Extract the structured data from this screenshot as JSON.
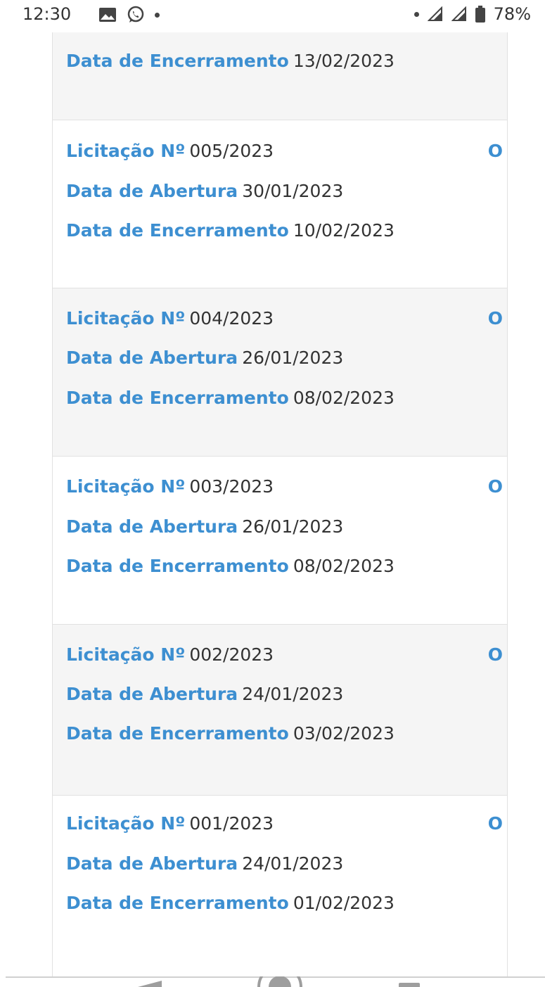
{
  "status_bar": {
    "time": "12:30",
    "battery": "78%",
    "icons": [
      "image-icon",
      "whatsapp-icon",
      "signal-icon",
      "battery-icon"
    ]
  },
  "labels": {
    "licitacao": "Licitação Nº",
    "abertura": "Data de Abertura",
    "encerramento": "Data de Encerramento"
  },
  "items": [
    {
      "encerramento": "13/02/2023"
    },
    {
      "numero": "005/2023",
      "abertura": "30/01/2023",
      "encerramento": "10/02/2023",
      "badge": "O"
    },
    {
      "numero": "004/2023",
      "abertura": "26/01/2023",
      "encerramento": "08/02/2023",
      "badge": "O"
    },
    {
      "numero": "003/2023",
      "abertura": "26/01/2023",
      "encerramento": "08/02/2023",
      "badge": "O"
    },
    {
      "numero": "002/2023",
      "abertura": "24/01/2023",
      "encerramento": "03/02/2023",
      "badge": "O"
    },
    {
      "numero": "001/2023",
      "abertura": "24/01/2023",
      "encerramento": "01/02/2023",
      "badge": "O"
    }
  ],
  "colors": {
    "accent": "#3d8fd1",
    "text": "#333333",
    "card_gray": "#f5f5f5",
    "card_white": "#ffffff"
  },
  "nav": {
    "icons": [
      "back-icon",
      "home-icon",
      "recent-apps-icon"
    ]
  }
}
